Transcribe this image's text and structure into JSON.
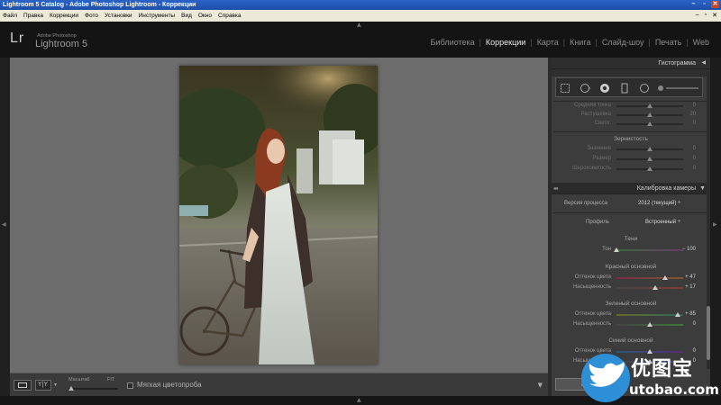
{
  "window": {
    "title": "Lightroom 5 Catalog - Adobe Photoshop Lightroom - Коррекции",
    "controls": [
      "–",
      "▫",
      "✕"
    ]
  },
  "menu": {
    "items": [
      "Файл",
      "Правка",
      "Коррекции",
      "Фото",
      "Установки",
      "Инструменты",
      "Вид",
      "Окно",
      "Справка"
    ],
    "right": [
      "–",
      "▫",
      "✕"
    ]
  },
  "header": {
    "logo": "Lr",
    "brand_small": "Adobe Photoshop",
    "brand_name": "Lightroom 5",
    "modules": [
      "Библиотека",
      "Коррекции",
      "Карта",
      "Книга",
      "Слайд-шоу",
      "Печать",
      "Web"
    ],
    "active_module": "Коррекции"
  },
  "panel": {
    "histogram_title": "Гистограмма",
    "effects_partial": {
      "rows": [
        {
          "label": "Средняя точка",
          "value": "0"
        },
        {
          "label": "Растушевка",
          "value": "20"
        },
        {
          "label": "Светл.",
          "value": "0"
        }
      ]
    },
    "grain": {
      "title": "Зернистость",
      "rows": [
        {
          "label": "Значение",
          "value": "0"
        },
        {
          "label": "Размер",
          "value": "0"
        },
        {
          "label": "Шероховатость",
          "value": "0"
        }
      ]
    },
    "calibration": {
      "title": "Калибровка камеры",
      "process_label": "Версия процесса",
      "process_value": "2012 (текущий)",
      "profile_label": "Профиль",
      "profile_value": "Встроенный",
      "shadows_title": "Тени",
      "shadows": [
        {
          "label": "Тон",
          "value": "− 100",
          "fraction": 0.0
        }
      ],
      "red_title": "Красный основной",
      "red": [
        {
          "label": "Оттенок цвета",
          "value": "+ 47",
          "fraction": 0.735
        },
        {
          "label": "Насыщенность",
          "value": "+ 17",
          "fraction": 0.585
        }
      ],
      "green_title": "Зеленый основной",
      "green": [
        {
          "label": "Оттенок цвета",
          "value": "+ 85",
          "fraction": 0.925
        },
        {
          "label": "Насыщенность",
          "value": "0",
          "fraction": 0.5
        }
      ],
      "blue_title": "Синий основной",
      "blue": [
        {
          "label": "Оттенок цвета",
          "value": "0",
          "fraction": 0.5
        },
        {
          "label": "Насыщенность",
          "value": "0",
          "fraction": 0.5
        }
      ]
    },
    "prev_button": "Предыд."
  },
  "bottombar": {
    "zoom_label": "Масштаб",
    "zoom_fit": "FIT",
    "softproof_label": "Мягкая цветопроба"
  },
  "watermark": {
    "text": "优图宝",
    "url": "utobao.com"
  }
}
